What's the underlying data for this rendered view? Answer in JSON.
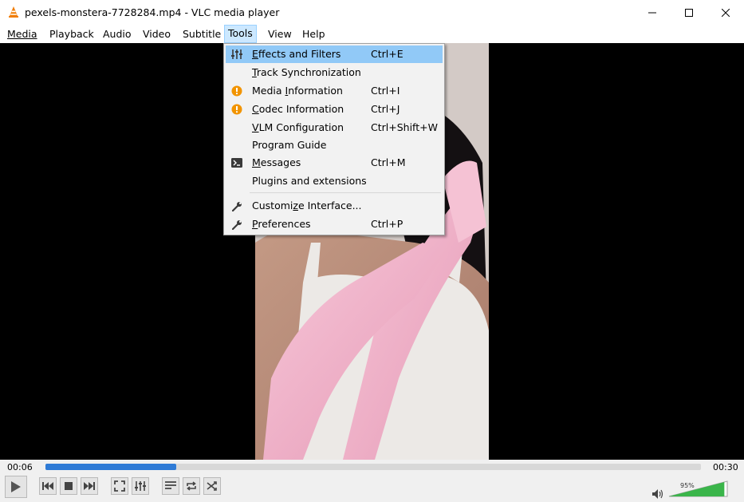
{
  "window": {
    "title": "pexels-monstera-7728284.mp4 - VLC media player"
  },
  "menubar": [
    {
      "label": "Media",
      "key": "M"
    },
    {
      "label": "Playback",
      "key": "l"
    },
    {
      "label": "Audio",
      "key": "A"
    },
    {
      "label": "Video",
      "key": "V"
    },
    {
      "label": "Subtitle",
      "key": "t"
    },
    {
      "label": "Tools",
      "key": "s"
    },
    {
      "label": "View",
      "key": "i"
    },
    {
      "label": "Help",
      "key": "H"
    }
  ],
  "tools_menu": {
    "items": [
      {
        "pre": "",
        "key": "E",
        "post": "ffects and Filters",
        "shortcut": "Ctrl+E",
        "icon": "equalizer-icon"
      },
      {
        "pre": "",
        "key": "T",
        "post": "rack Synchronization",
        "shortcut": "",
        "icon": ""
      },
      {
        "pre": "Media ",
        "key": "I",
        "post": "nformation",
        "shortcut": "Ctrl+I",
        "icon": "info-icon"
      },
      {
        "pre": "",
        "key": "C",
        "post": "odec Information",
        "shortcut": "Ctrl+J",
        "icon": "info-icon"
      },
      {
        "pre": "",
        "key": "V",
        "post": "LM Configuration",
        "shortcut": "Ctrl+Shift+W",
        "icon": ""
      },
      {
        "pre": "Program Guide",
        "key": "",
        "post": "",
        "shortcut": "",
        "icon": ""
      },
      {
        "pre": "",
        "key": "M",
        "post": "essages",
        "shortcut": "Ctrl+M",
        "icon": "terminal-icon"
      },
      {
        "pre": "Plugins and extensions",
        "key": "",
        "post": "",
        "shortcut": "",
        "icon": ""
      },
      {
        "pre": "Customi",
        "key": "z",
        "post": "e Interface...",
        "shortcut": "",
        "icon": "wrench-icon"
      },
      {
        "pre": "",
        "key": "P",
        "post": "references",
        "shortcut": "Ctrl+P",
        "icon": "wrench-icon"
      }
    ]
  },
  "playback": {
    "elapsed": "00:06",
    "duration": "00:30",
    "progress": 0.2,
    "volume_label": "95%",
    "volume": 0.95
  },
  "colors": {
    "highlight": "#91c9f7",
    "seek_fill": "#2f7bd6",
    "volume_fill": "#3ab54a",
    "info_icon": "#f29400"
  }
}
